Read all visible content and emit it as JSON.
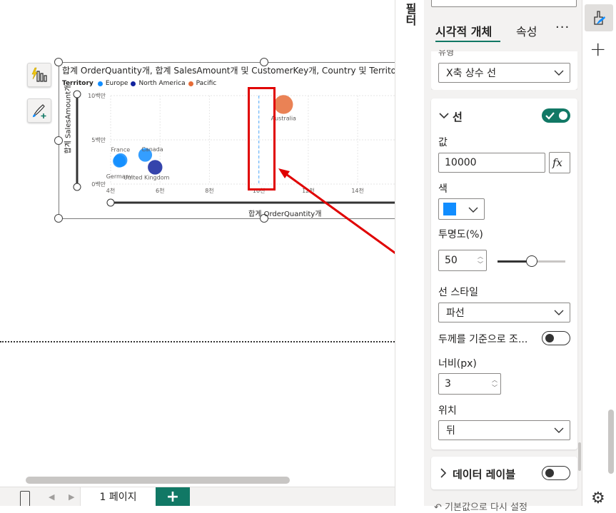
{
  "chart": {
    "title": "합계 OrderQuantity개, 합계 SalesAmount개 및 CustomerKey개, Country 및 Territo",
    "legend_title": "Territory",
    "legend": [
      {
        "label": "Europe",
        "color": "#118dff"
      },
      {
        "label": "North America",
        "color": "#12239e"
      },
      {
        "label": "Pacific",
        "color": "#e66c37"
      }
    ],
    "y_title": "합계 SalesAmount개",
    "x_title": "합계 OrderQuantity개",
    "y_ticks": [
      "10백만",
      "5백만",
      "0백만"
    ],
    "x_ticks": [
      "4천",
      "6천",
      "8천",
      "10천",
      "12천",
      "14천"
    ]
  },
  "chart_data": {
    "type": "scatter",
    "title": "합계 OrderQuantity개, 합계 SalesAmount개 및 CustomerKey개, Country 및 Territo",
    "xlabel": "합계 OrderQuantity개",
    "ylabel": "합계 SalesAmount개",
    "xlim": [
      4000,
      15500
    ],
    "ylim": [
      0,
      10000000
    ],
    "constant_line_x": 10000,
    "points": [
      {
        "label": "Australia",
        "x": 11000,
        "y": 9000000,
        "territory": "Pacific",
        "color": "#e66c37",
        "size": 2.2
      },
      {
        "label": "France",
        "x": 4400,
        "y": 2700000,
        "territory": "Europe",
        "color": "#118dff",
        "size": 1.6
      },
      {
        "label": "Canada",
        "x": 5400,
        "y": 3300000,
        "territory": "North America",
        "color": "#118dff",
        "size": 1.6
      },
      {
        "label": "United Kingdom",
        "x": 5800,
        "y": 1900000,
        "territory": "Europe",
        "color": "#12239e",
        "size": 1.7
      },
      {
        "label": "Germany",
        "x": 4350,
        "y": 2600000,
        "territory": "Europe",
        "color": "#118dff",
        "size": 1.5
      }
    ],
    "grid": true
  },
  "pages": {
    "current": "1 페이지",
    "add": "+"
  },
  "filters": {
    "label": "필터"
  },
  "pane": {
    "top_value": "",
    "tab_visual": "시각적 개체",
    "tab_general": "속성",
    "more": "···",
    "type_partial": "유형",
    "type_value": "X축 상수 선",
    "line_section": "선",
    "value_label": "값",
    "value": "10000",
    "fx": "fx",
    "color_label": "색",
    "color_value": "#118dff",
    "transparency_label": "투명도(%)",
    "transparency": "50",
    "transparency_fraction": 0.5,
    "style_label": "선 스타일",
    "style_value": "파선",
    "scale_label": "두께를 기준으로 조...",
    "width_label": "너비(px)",
    "width_value": "3",
    "position_label": "위치",
    "position_value": "뒤",
    "data_labels": "데이터 레이블",
    "footer_partial": "기본값으로 다시 설정"
  }
}
